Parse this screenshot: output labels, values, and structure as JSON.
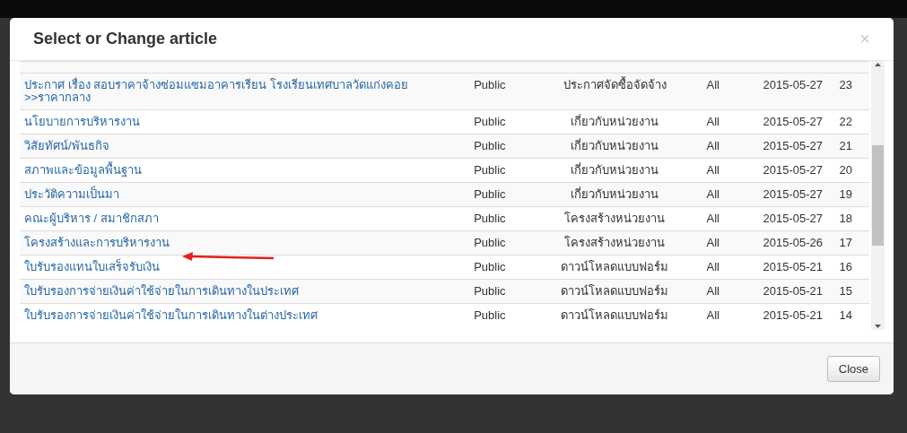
{
  "modal": {
    "title": "Select or Change article",
    "close_icon": "×",
    "rows": [
      {
        "title": "ประกาศ เรื่อง สอบราคาจ้างซ่อมแซมอาคารเรียน โรงเรียนเทศบาลวัดแก่งคอย >>ราคากลาง",
        "access": "Public",
        "category": "ประกาศจัดซื้อจัดจ้าง",
        "language": "All",
        "date": "2015-05-27",
        "id": "23"
      },
      {
        "title": "นโยบายการบริหารงาน",
        "access": "Public",
        "category": "เกี่ยวกับหน่วยงาน",
        "language": "All",
        "date": "2015-05-27",
        "id": "22"
      },
      {
        "title": "วิสัยทัศน์/พันธกิจ",
        "access": "Public",
        "category": "เกี่ยวกับหน่วยงาน",
        "language": "All",
        "date": "2015-05-27",
        "id": "21"
      },
      {
        "title": "สภาพและข้อมูลพื้นฐาน",
        "access": "Public",
        "category": "เกี่ยวกับหน่วยงาน",
        "language": "All",
        "date": "2015-05-27",
        "id": "20"
      },
      {
        "title": "ประวัติความเป็นมา",
        "access": "Public",
        "category": "เกี่ยวกับหน่วยงาน",
        "language": "All",
        "date": "2015-05-27",
        "id": "19"
      },
      {
        "title": "คณะผู้บริหาร / สมาชิกสภา",
        "access": "Public",
        "category": "โครงสร้างหน่วยงาน",
        "language": "All",
        "date": "2015-05-27",
        "id": "18"
      },
      {
        "title": "โครงสร้างและการบริหารงาน",
        "access": "Public",
        "category": "โครงสร้างหน่วยงาน",
        "language": "All",
        "date": "2015-05-26",
        "id": "17"
      },
      {
        "title": "ใบรับรองแทนใบเสร็จรับเงิน",
        "access": "Public",
        "category": "ดาวน์โหลดแบบฟอร์ม",
        "language": "All",
        "date": "2015-05-21",
        "id": "16"
      },
      {
        "title": "ใบรับรองการจ่ายเงินค่าใช้จ่ายในการเดินทางในประเทศ",
        "access": "Public",
        "category": "ดาวน์โหลดแบบฟอร์ม",
        "language": "All",
        "date": "2015-05-21",
        "id": "15"
      },
      {
        "title": "ใบรับรองการจ่ายเงินค่าใช้จ่ายในการเดินทางในต่างประเทศ",
        "access": "Public",
        "category": "ดาวน์โหลดแบบฟอร์ม",
        "language": "All",
        "date": "2015-05-21",
        "id": "14"
      }
    ],
    "close_button": "Close"
  }
}
